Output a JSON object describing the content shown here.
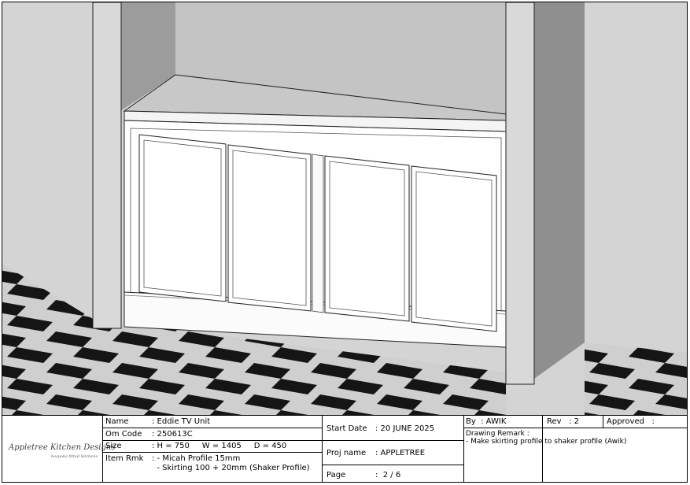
{
  "logo": {
    "brand": "Appletree Kitchen Designs",
    "tagline": "bespoke fitted kitchens"
  },
  "item": {
    "name_label": "Name",
    "name_value": ": Eddie TV Unit",
    "code_label": "Om Code",
    "code_value": ": 250613C",
    "size_label": "Size",
    "size_value": ": H = 750     W = 1405     D = 450",
    "remark_label": "Item Rmk",
    "remark_line1": ": - Micah Profile 15mm",
    "remark_line2": "  - Skirting 100 + 20mm (Shaker Profile)"
  },
  "project": {
    "start_label": "Start Date",
    "start_value": ": 20 JUNE 2025",
    "proj_label": "Proj name",
    "proj_value": ": APPLETREE",
    "page_label": "Page",
    "page_value": ":  2 / 6"
  },
  "approval": {
    "by_text": "By  : AWIK",
    "rev_text": "Rev   : 2",
    "approved_text": "Approved   :",
    "remark_title": "Drawing Remark :",
    "remark_text": "- Make skirting profile to shaker profile (Awik)"
  },
  "colors": {
    "wall": "#d6d6d6",
    "pillar_front": "#d8d8d8",
    "pillar_side": "#9e9e9e",
    "floor_light": "#cfcfcf",
    "floor_dark": "#151515",
    "cabinet": "#ffffff",
    "top_surface": "#c9c9c9"
  }
}
